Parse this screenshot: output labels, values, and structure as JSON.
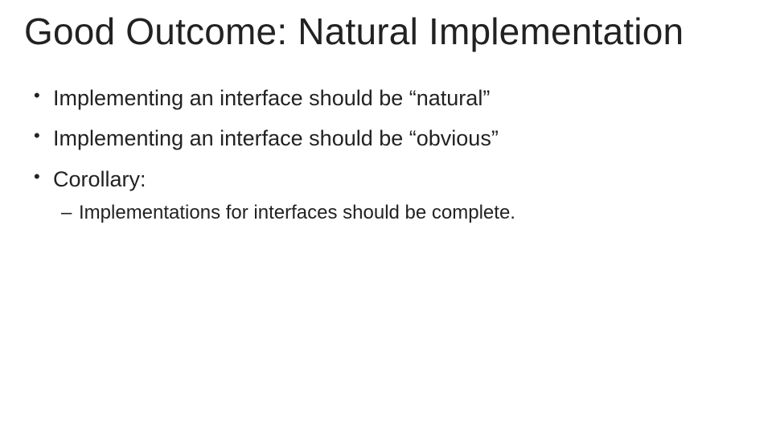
{
  "slide": {
    "title": "Good Outcome: Natural Implementation",
    "bullets": [
      {
        "text": "Implementing an interface should be “natural”"
      },
      {
        "text": "Implementing an interface should be “obvious”"
      },
      {
        "text": "Corollary:",
        "sub": [
          "Implementations for interfaces should be complete."
        ]
      }
    ]
  }
}
